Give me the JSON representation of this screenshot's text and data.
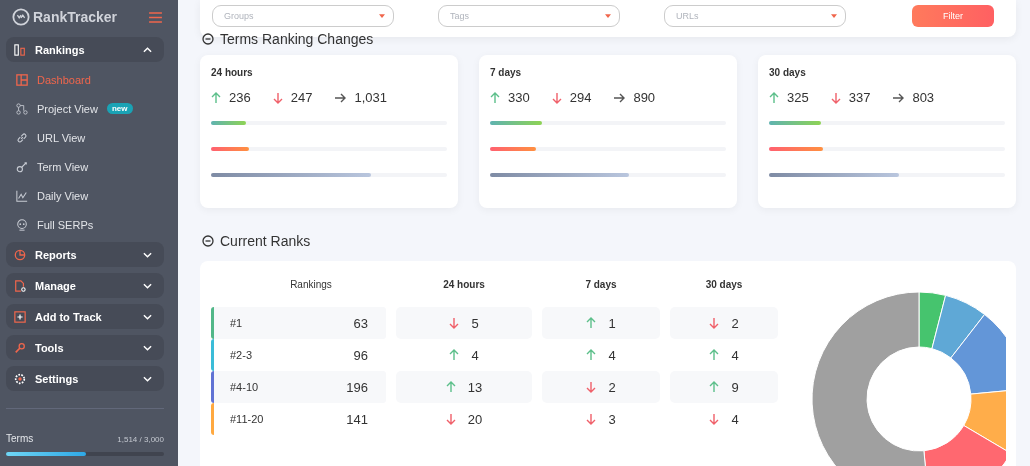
{
  "sidebar": {
    "logo": {
      "name": "RankTracker"
    },
    "nav": [
      {
        "label": "Rankings",
        "expanded": true,
        "children": [
          {
            "label": "Dashboard",
            "selected": true
          },
          {
            "label": "Project View",
            "selected": false,
            "badge": "new"
          },
          {
            "label": "URL View",
            "selected": false
          },
          {
            "label": "Term View",
            "selected": false
          },
          {
            "label": "Daily View",
            "selected": false
          },
          {
            "label": "Full SERPs",
            "selected": false
          }
        ]
      },
      {
        "label": "Reports",
        "expanded": false
      },
      {
        "label": "Manage",
        "expanded": false
      },
      {
        "label": "Add to Track",
        "expanded": false
      },
      {
        "label": "Tools",
        "expanded": false
      },
      {
        "label": "Settings",
        "expanded": false
      }
    ],
    "usage": {
      "label": "Terms",
      "reading": "1,514 / 3,000",
      "level": 0.505
    }
  },
  "filters": {
    "dropdowns": [
      {
        "placeholder": "Groups"
      },
      {
        "placeholder": "Tags"
      },
      {
        "placeholder": "URLs"
      }
    ],
    "button": "Filter"
  },
  "changes": {
    "title": "Terms Ranking Changes",
    "cards": [
      {
        "period": "24 hours",
        "up": "236",
        "down": "247",
        "flat": "1,031",
        "bars": [
          {
            "kind": "up",
            "level": 0.15
          },
          {
            "kind": "down",
            "level": 0.16
          },
          {
            "kind": "flat",
            "level": 0.68
          }
        ]
      },
      {
        "period": "7 days",
        "up": "330",
        "down": "294",
        "flat": "890",
        "bars": [
          {
            "kind": "up",
            "level": 0.22
          },
          {
            "kind": "down",
            "level": 0.195
          },
          {
            "kind": "flat",
            "level": 0.59
          }
        ]
      },
      {
        "period": "30 days",
        "up": "325",
        "down": "337",
        "flat": "803",
        "bars": [
          {
            "kind": "up",
            "level": 0.22
          },
          {
            "kind": "down",
            "level": 0.23
          },
          {
            "kind": "flat",
            "level": 0.55
          }
        ]
      }
    ]
  },
  "current": {
    "title": "Current Ranks",
    "columns": [
      "Rankings",
      "24 hours",
      "7 days",
      "30 days"
    ],
    "rows": [
      {
        "range": "#1",
        "count": "63",
        "color": "#52b788",
        "changes": [
          {
            "kind": "down",
            "value": "5"
          },
          {
            "kind": "up",
            "value": "1"
          },
          {
            "kind": "down",
            "value": "2"
          }
        ]
      },
      {
        "range": "#2-3",
        "count": "96",
        "color": "#3bbcd8",
        "changes": [
          {
            "kind": "up",
            "value": "4"
          },
          {
            "kind": "up",
            "value": "4"
          },
          {
            "kind": "up",
            "value": "4"
          }
        ]
      },
      {
        "range": "#4-10",
        "count": "196",
        "color": "#6173d4",
        "changes": [
          {
            "kind": "up",
            "value": "13"
          },
          {
            "kind": "down",
            "value": "2"
          },
          {
            "kind": "up",
            "value": "9"
          }
        ]
      },
      {
        "range": "#11-20",
        "count": "141",
        "color": "#ffa940",
        "changes": [
          {
            "kind": "down",
            "value": "20"
          },
          {
            "kind": "down",
            "value": "3"
          },
          {
            "kind": "down",
            "value": "4"
          }
        ]
      }
    ]
  }
}
